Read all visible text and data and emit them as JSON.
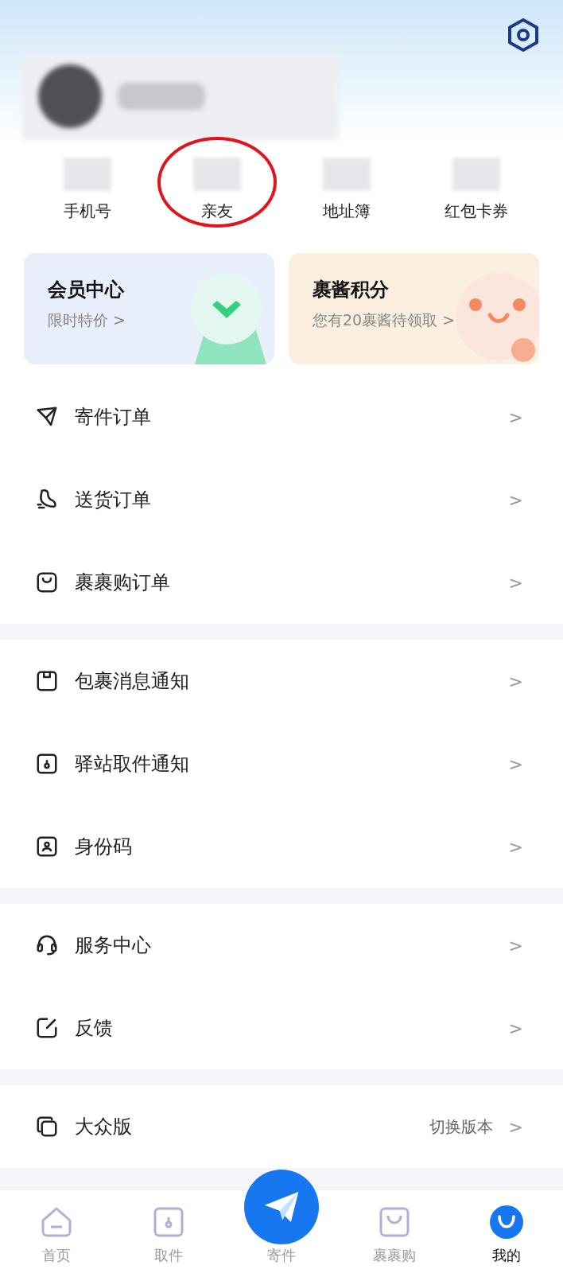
{
  "stats": [
    {
      "label": "手机号",
      "circled": false
    },
    {
      "label": "亲友",
      "circled": true
    },
    {
      "label": "地址簿",
      "circled": false
    },
    {
      "label": "红包卡券",
      "circled": false
    }
  ],
  "cards": [
    {
      "title": "会员中心",
      "subtitle": "限时特价",
      "chevron": ">"
    },
    {
      "title": "裹酱积分",
      "subtitle": "您有20裹酱待领取",
      "chevron": ">"
    }
  ],
  "menu_groups": [
    [
      {
        "label": "寄件订单",
        "chevron": ">"
      },
      {
        "label": "送货订单",
        "chevron": ">"
      },
      {
        "label": "裹裹购订单",
        "chevron": ">"
      }
    ],
    [
      {
        "label": "包裹消息通知",
        "chevron": ">"
      },
      {
        "label": "驿站取件通知",
        "chevron": ">"
      },
      {
        "label": "身份码",
        "chevron": ">"
      }
    ],
    [
      {
        "label": "服务中心",
        "chevron": ">"
      },
      {
        "label": "反馈",
        "chevron": ">"
      }
    ],
    [
      {
        "label": "大众版",
        "value": "切换版本",
        "chevron": ">"
      }
    ]
  ],
  "tab_bar": [
    {
      "label": "首页",
      "selected": false,
      "kind": "tab"
    },
    {
      "label": "取件",
      "selected": false,
      "kind": "tab"
    },
    {
      "label": "寄件",
      "selected": false,
      "kind": "main"
    },
    {
      "label": "裹裹购",
      "selected": false,
      "kind": "tab"
    },
    {
      "label": "我的",
      "selected": true,
      "kind": "tab"
    }
  ]
}
